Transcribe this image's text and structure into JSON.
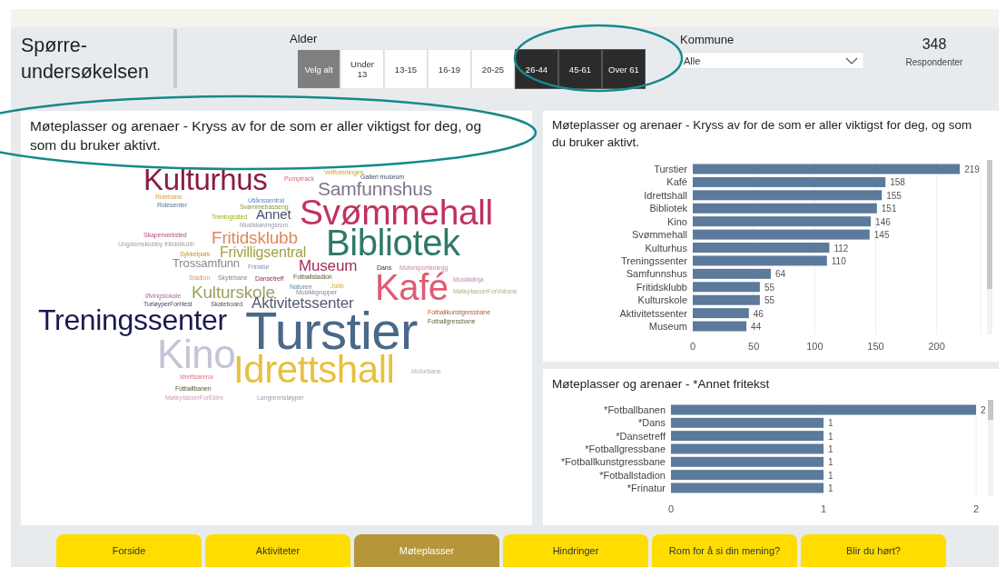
{
  "report": {
    "title": "Spørre-undersøkelsen"
  },
  "age_filter": {
    "label": "Alder",
    "options": [
      {
        "label": "Velg alt",
        "kind": "select_all",
        "selected": false
      },
      {
        "label": "Under 13",
        "kind": "option",
        "selected": false
      },
      {
        "label": "13-15",
        "kind": "option",
        "selected": false
      },
      {
        "label": "16-19",
        "kind": "option",
        "selected": false
      },
      {
        "label": "20-25",
        "kind": "option",
        "selected": false
      },
      {
        "label": "26-44",
        "kind": "option",
        "selected": true
      },
      {
        "label": "45-61",
        "kind": "option",
        "selected": true
      },
      {
        "label": "Over 61",
        "kind": "option",
        "selected": true
      }
    ]
  },
  "municipality_filter": {
    "label": "Kommune",
    "value": "Alle"
  },
  "respondents": {
    "count": "348",
    "label": "Respondenter"
  },
  "word_cloud": {
    "title": "Møteplasser og arenaer - Kryss av for de som er aller viktigst for deg, og som du bruker aktivt.",
    "words": [
      "Kulturhus",
      "Vellforeningen",
      "Pumptrack",
      "Galleri museum",
      "Ridebane",
      "Samfunnshus",
      "Utlånssentral",
      "Ridesenter",
      "Svømmebasseng",
      "Treningssted",
      "Annet",
      "Musikkøvingsrom",
      "Svømmehall",
      "Skaperverksted",
      "Fritidsklubb",
      "Ungdomsklubby fritidsklubb",
      "Sykkelpark",
      "Frivilligsentral",
      "Bibliotek",
      "Trossamfunn",
      "Frinatur",
      "Museum",
      "Dans",
      "Motorsportanlegg",
      "Stadion",
      "Skytebane",
      "Dansetreff",
      "Fotballstadion",
      "Øvingslokale",
      "Kulturskole",
      "Naturen",
      "Musikkgrupper",
      "Jobb",
      "Kafé",
      "Musikklinja",
      "MøteplasserForVoksne",
      "TurløyperForHest",
      "Skateboard",
      "Aktivitetssenter",
      "Treningssenter",
      "Turstier",
      "Fotballkunstgressbane",
      "Fotballgressbane",
      "Kino",
      "Idrettsarena",
      "Idrettshall",
      "Motorbane",
      "Fotballbanen",
      "MøteplasserForEldre",
      "Langrennsløyper"
    ]
  },
  "bar_chart": {
    "title": "Møteplasser og arenaer - Kryss av for de som er aller viktigst for deg, og som du bruker aktivt.",
    "chart_data": {
      "type": "bar",
      "orientation": "horizontal",
      "categories": [
        "Turstier",
        "Kafé",
        "Idrettshall",
        "Bibliotek",
        "Kino",
        "Svømmehall",
        "Kulturhus",
        "Treningssenter",
        "Samfunnshus",
        "Fritidsklubb",
        "Kulturskole",
        "Aktivitetssenter",
        "Museum"
      ],
      "series": [
        {
          "color": "#5b7a9c",
          "values": [
            219,
            158,
            155,
            151,
            146,
            145,
            112,
            110,
            64,
            55,
            55,
            46,
            44
          ]
        }
      ],
      "xlim": [
        0,
        236
      ],
      "xticks": [
        0,
        50,
        100,
        150,
        200
      ],
      "grid": true,
      "data_labels": true
    }
  },
  "other_chart": {
    "title": "Møteplasser og arenaer - *Annet fritekst",
    "chart_data": {
      "type": "bar",
      "orientation": "horizontal",
      "categories": [
        "*Fotballbanen",
        "*Dans",
        "*Dansetreff",
        "*Fotballgressbane",
        "*Fotballkunstgressbane",
        "*Fotballstadion",
        "*Frinatur"
      ],
      "series": [
        {
          "color": "#5b7a9c",
          "values": [
            2,
            1,
            1,
            1,
            1,
            1,
            1
          ]
        }
      ],
      "xlim": [
        0,
        2
      ],
      "xticks": [
        0,
        1,
        2
      ],
      "grid": true,
      "data_labels": true
    }
  },
  "nav": [
    {
      "label": "Forside",
      "selected": false
    },
    {
      "label": "Aktiviteter",
      "selected": false
    },
    {
      "label": "Møteplasser",
      "selected": true
    },
    {
      "label": "Hindringer",
      "selected": false
    },
    {
      "label": "Rom for å si din mening?",
      "selected": false
    },
    {
      "label": "Blir du hørt?",
      "selected": false
    }
  ]
}
